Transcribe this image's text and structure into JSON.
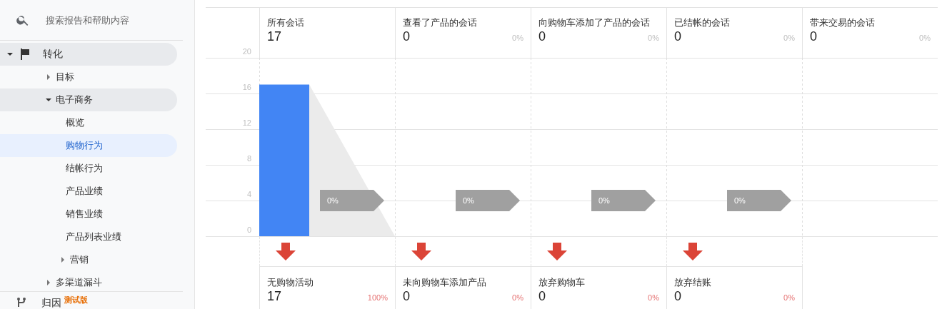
{
  "search": {
    "placeholder": "搜索报告和帮助内容"
  },
  "nav": [
    {
      "label": "转化",
      "kind": "folder",
      "expanded": true,
      "selected": false,
      "children": [
        {
          "label": "目标",
          "kind": "folder",
          "expanded": false,
          "selected": false
        },
        {
          "label": "电子商务",
          "kind": "folder",
          "expanded": true,
          "selected": false,
          "children": [
            {
              "label": "概览",
              "kind": "page",
              "selected": false
            },
            {
              "label": "购物行为",
              "kind": "page",
              "selected": true
            },
            {
              "label": "结帐行为",
              "kind": "page",
              "selected": false
            },
            {
              "label": "产品业绩",
              "kind": "page",
              "selected": false
            },
            {
              "label": "销售业绩",
              "kind": "page",
              "selected": false
            },
            {
              "label": "产品列表业绩",
              "kind": "page",
              "selected": false
            },
            {
              "label": "营销",
              "kind": "folder",
              "expanded": false,
              "selected": false
            }
          ]
        },
        {
          "label": "多渠道漏斗",
          "kind": "folder",
          "expanded": false,
          "selected": false
        }
      ]
    }
  ],
  "nav_footer": {
    "label": "归因",
    "badge": "测试版"
  },
  "stages": [
    {
      "label": "所有会话",
      "value": "17",
      "rate": "0%"
    },
    {
      "label": "查看了产品的会话",
      "value": "0",
      "share": "0%",
      "rate": "0%"
    },
    {
      "label": "向购物车添加了产品的会话",
      "value": "0",
      "share": "0%",
      "rate": "0%"
    },
    {
      "label": "已结帐的会话",
      "value": "0",
      "share": "0%",
      "rate": "0%"
    },
    {
      "label": "带来交易的会话",
      "value": "0",
      "share": "0%"
    }
  ],
  "chart": {
    "chart_data": {
      "type": "bar",
      "values": [
        17,
        0,
        0,
        0,
        0
      ],
      "ylim": [
        0,
        20
      ],
      "grid": true,
      "yticks": [
        0,
        4,
        8,
        12,
        16,
        20
      ]
    }
  },
  "exits": [
    {
      "label": "无购物活动",
      "value": "17",
      "share": "100%"
    },
    {
      "label": "未向购物车添加产品",
      "value": "0",
      "share": "0%"
    },
    {
      "label": "放弃购物车",
      "value": "0",
      "share": "0%"
    },
    {
      "label": "放弃结账",
      "value": "0",
      "share": "0%"
    }
  ]
}
